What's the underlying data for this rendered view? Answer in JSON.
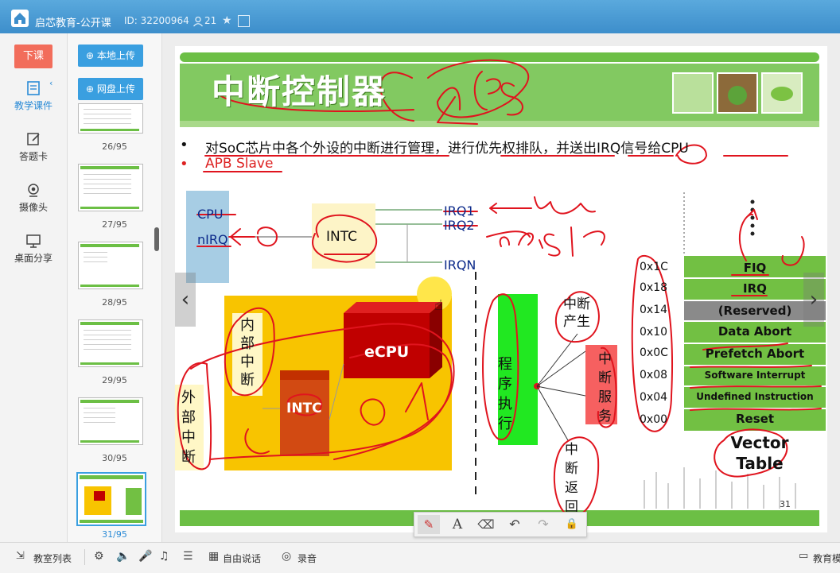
{
  "titlebar": {
    "app_title": "启芯教育-公开课",
    "room_id": "ID: 32200964",
    "user_count": "21"
  },
  "left_tools": {
    "end_class": "下课",
    "items": [
      {
        "label": "教学课件",
        "icon": "courseware-icon"
      },
      {
        "label": "答题卡",
        "icon": "answer-card-icon"
      },
      {
        "label": "摄像头",
        "icon": "camera-icon"
      },
      {
        "label": "桌面分享",
        "icon": "screen-share-icon"
      }
    ]
  },
  "thumbnails": {
    "upload_local": "本地上传",
    "upload_cloud": "网盘上传",
    "pages": [
      "26/95",
      "27/95",
      "28/95",
      "29/95",
      "30/95",
      "31/95"
    ],
    "current_page": "31/95"
  },
  "slide": {
    "title": "中断控制器",
    "bullet1": "对SoC芯片中各个外设的中断进行管理，进行优先权排队，并送出IRQ信号给CPU",
    "bullet2": "APB Slave",
    "cpu_label": "CPU",
    "nirq_label": "nIRQ",
    "intc_label": "INTC",
    "irq1": "IRQ1",
    "irq2": "IRQ2",
    "irqn": "IRQN",
    "internal_int": "内部中断",
    "external_int": "外部中断",
    "ecpu": "eCPU",
    "intc_inner": "INTC",
    "program_exec": "程序执行",
    "int_occur": "中断产生",
    "int_service": "中断服务",
    "int_return": "中断返回",
    "addresses": [
      "0x1C",
      "0x18",
      "0x14",
      "0x10",
      "0x0C",
      "0x08",
      "0x04",
      "0x00"
    ],
    "vectors": [
      "FIQ",
      "IRQ",
      "(Reserved)",
      "Data Abort",
      "Prefetch Abort",
      "Software Interrupt",
      "Undefined Instruction",
      "Reset"
    ],
    "vector_table": "Vector Table",
    "page_number": "31"
  },
  "colors": {
    "slide_green": "#6cbf45",
    "vector_green": "#72c043",
    "reserved_gray": "#8a8a8a",
    "annotation_red": "#e0141e",
    "chip_yellow": "#f8c400",
    "ecpu_red": "#c00000"
  },
  "bottom": {
    "classroom_list": "教室列表",
    "free_talk": "自由说话",
    "record": "录音",
    "education": "教育模"
  }
}
